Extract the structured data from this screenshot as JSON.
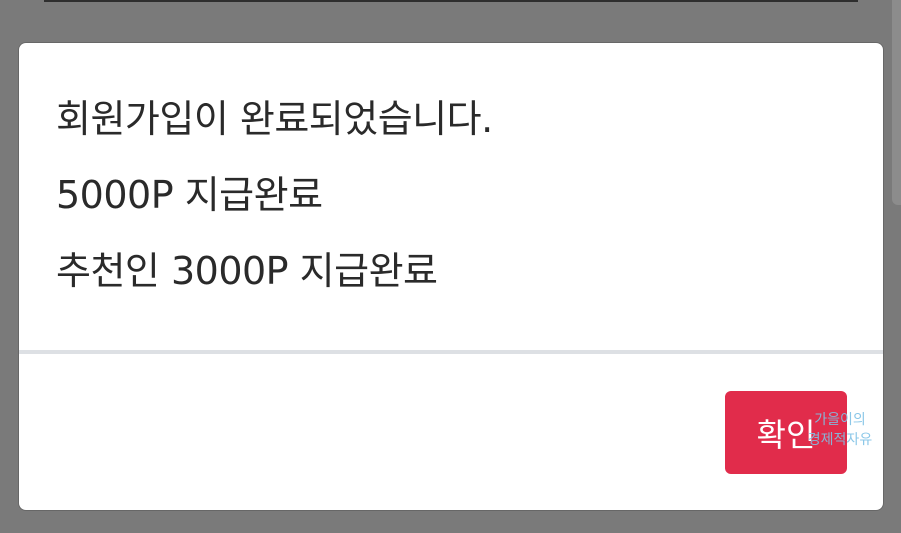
{
  "dialog": {
    "message_lines": [
      "회원가입이 완료되었습니다.",
      "5000P 지급완료",
      "추천인 3000P 지급완료"
    ],
    "confirm_label": "확인"
  },
  "watermark": {
    "line1": "가을이의",
    "line2": "경제적자유"
  },
  "colors": {
    "backdrop": "#7a7a7a",
    "dialog_bg": "#ffffff",
    "text": "#2a2a2a",
    "button": "#e12c4b",
    "divider": "#dde0e4",
    "watermark": "#7fc2e6"
  }
}
